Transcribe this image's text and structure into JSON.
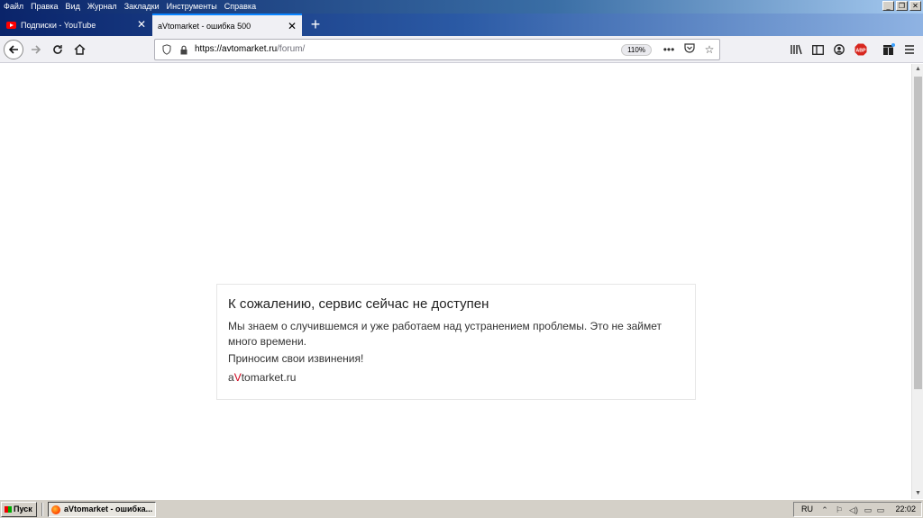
{
  "menu": {
    "items": [
      "Файл",
      "Правка",
      "Вид",
      "Журнал",
      "Закладки",
      "Инструменты",
      "Справка"
    ]
  },
  "window_controls": {
    "minimize": "_",
    "restore": "❐",
    "close": "✕"
  },
  "tabs": [
    {
      "label": "Подписки - YouTube",
      "icon": "youtube-icon",
      "active": false
    },
    {
      "label": "aVtomarket - ошибка 500",
      "active": true
    }
  ],
  "newtab_label": "+",
  "urlbar": {
    "host": "https://avtomarket.ru",
    "path": "/forum/",
    "zoom": "110%"
  },
  "toolbar_icons": [
    "library-icon",
    "sidebar-icon",
    "account-icon",
    "adblock-icon",
    "extensions-icon",
    "menu-icon"
  ],
  "adblock_label": "ABP",
  "error": {
    "title": "К сожалению, сервис сейчас не доступен",
    "message": "Мы знаем о случившемся и уже работаем над устранением проблемы. Это не займет много времени.",
    "apology": "Приносим свои извинения!",
    "brand_prefix": "a",
    "brand_accent": "V",
    "brand_suffix": "tomarket.ru",
    "accent_color": "#d0021b"
  },
  "taskbar": {
    "start_label": "Пуск",
    "task_label": "aVtomarket - ошибка...",
    "lang": "RU",
    "clock": "22:02"
  }
}
